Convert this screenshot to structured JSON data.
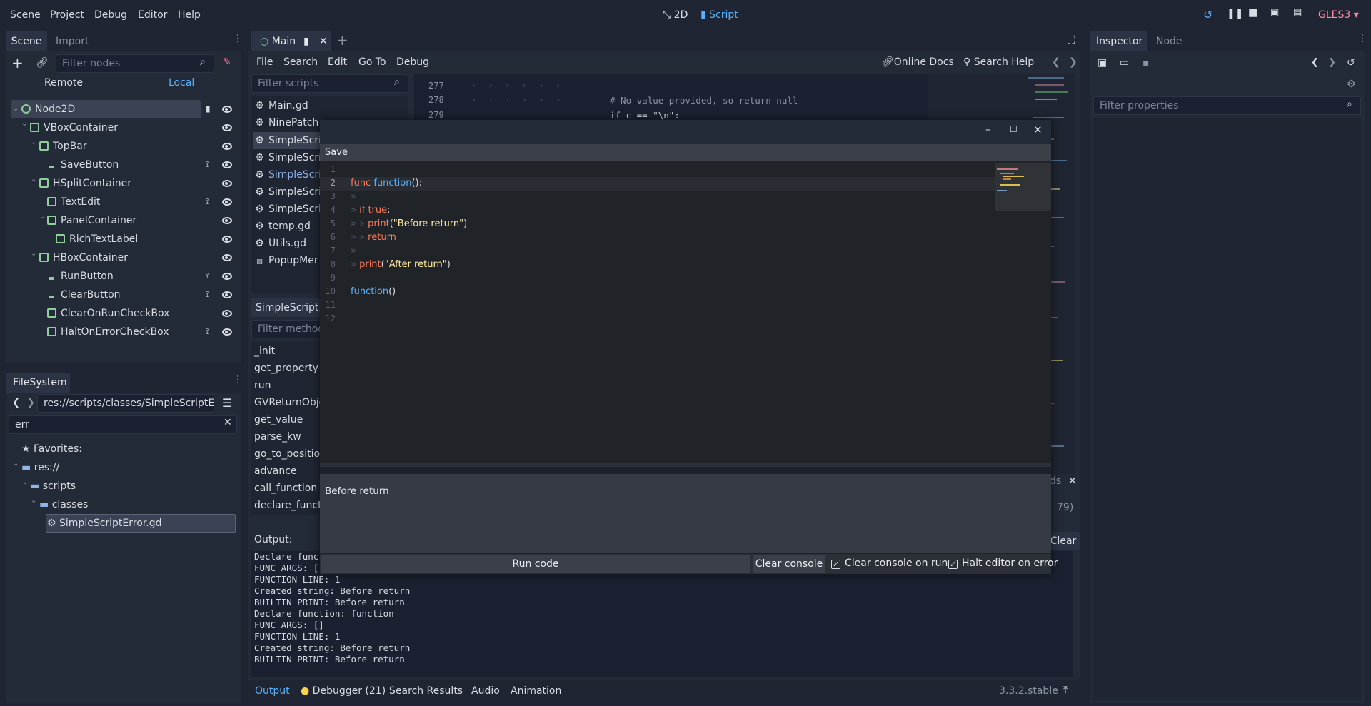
{
  "menu": {
    "scene": "Scene",
    "project": "Project",
    "debug": "Debug",
    "editor": "Editor",
    "help": "Help"
  },
  "workspace": {
    "twod": "2D",
    "script": "Script"
  },
  "renderer": "GLES3",
  "scene_dock": {
    "tab_scene": "Scene",
    "tab_import": "Import",
    "filter_placeholder": "Filter nodes",
    "remote": "Remote",
    "local": "Local",
    "nodes": [
      "Node2D",
      "VBoxContainer",
      "TopBar",
      "SaveButton",
      "HSplitContainer",
      "TextEdit",
      "PanelContainer",
      "RichTextLabel",
      "HBoxContainer",
      "RunButton",
      "ClearButton",
      "ClearOnRunCheckBox",
      "HaltOnErrorCheckBox"
    ]
  },
  "filesystem": {
    "title": "FileSystem",
    "path": "res://scripts/classes/SimpleScriptEr",
    "search": "err",
    "favorites": "Favorites:",
    "tree": [
      "res://",
      "scripts",
      "classes",
      "SimpleScriptError.gd"
    ]
  },
  "script_editor": {
    "tab_main": "Main",
    "menu": {
      "file": "File",
      "search": "Search",
      "edit": "Edit",
      "goto": "Go To",
      "debug": "Debug"
    },
    "online_docs": "Online Docs",
    "search_help": "Search Help",
    "filter_scripts": "Filter scripts",
    "scripts": [
      "Main.gd",
      "NinePatch",
      "SimpleScri",
      "SimpleScri",
      "SimpleScri",
      "SimpleScri",
      "SimpleScri",
      "temp.gd",
      "Utils.gd",
      "PopupMer"
    ],
    "current_script": "SimpleScript.",
    "filter_methods": "Filter method",
    "methods": [
      "_init",
      "get_property",
      "run",
      "GVReturnObje",
      "get_value",
      "parse_kw",
      "go_to_position",
      "advance",
      "call_function",
      "declare_funct"
    ],
    "bg_lines": {
      "l277": "277",
      "l278": "278",
      "l279": "279",
      "c278": "# No value provided, so return null",
      "c279": "if c == \"\\n\":"
    },
    "bg_right1": "ds",
    "bg_right2": "79)"
  },
  "popup": {
    "save": "Save",
    "lines": [
      "1",
      "2",
      "3",
      "4",
      "5",
      "6",
      "7",
      "8",
      "9",
      "10",
      "11",
      "12"
    ],
    "code": {
      "func_kw": "func",
      "func_name": "function",
      "func_paren": "():",
      "if_kw": "if",
      "true_kw": "true",
      "colon": ":",
      "print1": "print",
      "str1": "\"Before return\"",
      "return_kw": "return",
      "print2": "print",
      "str2": "\"After return\"",
      "call": "function",
      "call_paren": "()"
    },
    "console": "Before return",
    "run_code": "Run code",
    "clear_console": "Clear console",
    "clear_on_run": "Clear console on run",
    "halt_on_error": "Halt editor on error"
  },
  "output": {
    "title": "Output:",
    "clear": "Clear",
    "lines": [
      "Declare func",
      "FUNC ARGS: [",
      "FUNCTION LINE: 1",
      "Created string: Before return",
      "BUILTIN PRINT: Before return",
      "Declare function: function",
      "FUNC ARGS: []",
      "FUNCTION LINE: 1",
      "Created string: Before return",
      "BUILTIN PRINT: Before return"
    ]
  },
  "bottom_tabs": {
    "output": "Output",
    "debugger": "Debugger (21)",
    "search_results": "Search Results",
    "audio": "Audio",
    "animation": "Animation",
    "version": "3.3.2.stable"
  },
  "inspector": {
    "tab_inspector": "Inspector",
    "tab_node": "Node",
    "filter": "Filter properties"
  },
  "colors": {
    "accent": "#57b3ff",
    "bg": "#1f2532",
    "panel": "#232a38",
    "keyword": "#ff7085",
    "string": "#ffeda1"
  }
}
